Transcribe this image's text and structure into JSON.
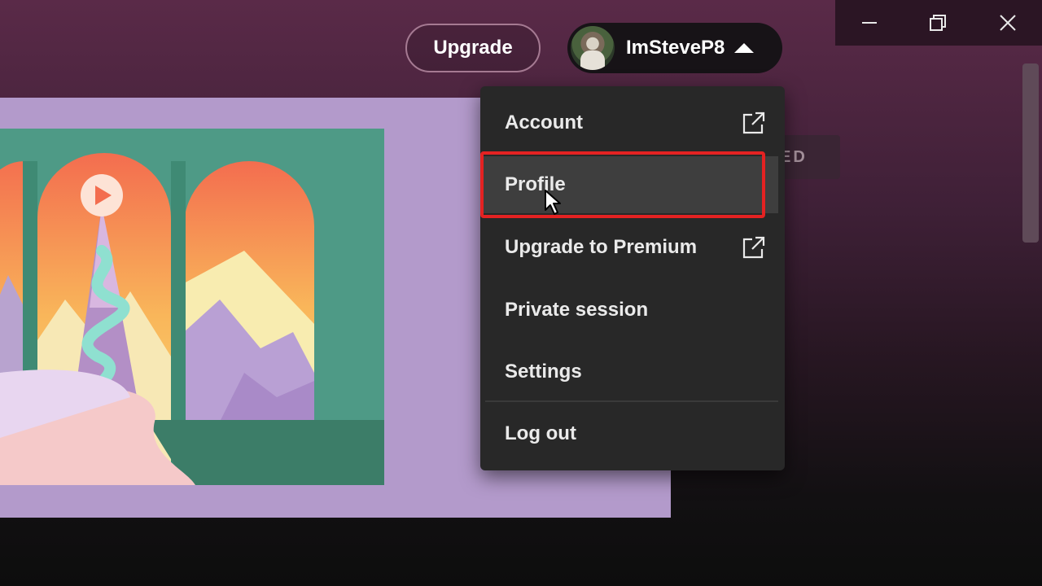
{
  "header": {
    "upgrade_label": "Upgrade",
    "username": "ImSteveP8"
  },
  "badge_fragment": "ED",
  "menu": {
    "items": [
      {
        "label": "Account",
        "external": true
      },
      {
        "label": "Profile",
        "external": false
      },
      {
        "label": "Upgrade to Premium",
        "external": true
      },
      {
        "label": "Private session",
        "external": false
      },
      {
        "label": "Settings",
        "external": false
      },
      {
        "label": "Log out",
        "external": false
      }
    ]
  },
  "colors": {
    "highlight": "#e42222",
    "menu_bg": "#282828",
    "hover_bg": "#3e3e3e"
  }
}
